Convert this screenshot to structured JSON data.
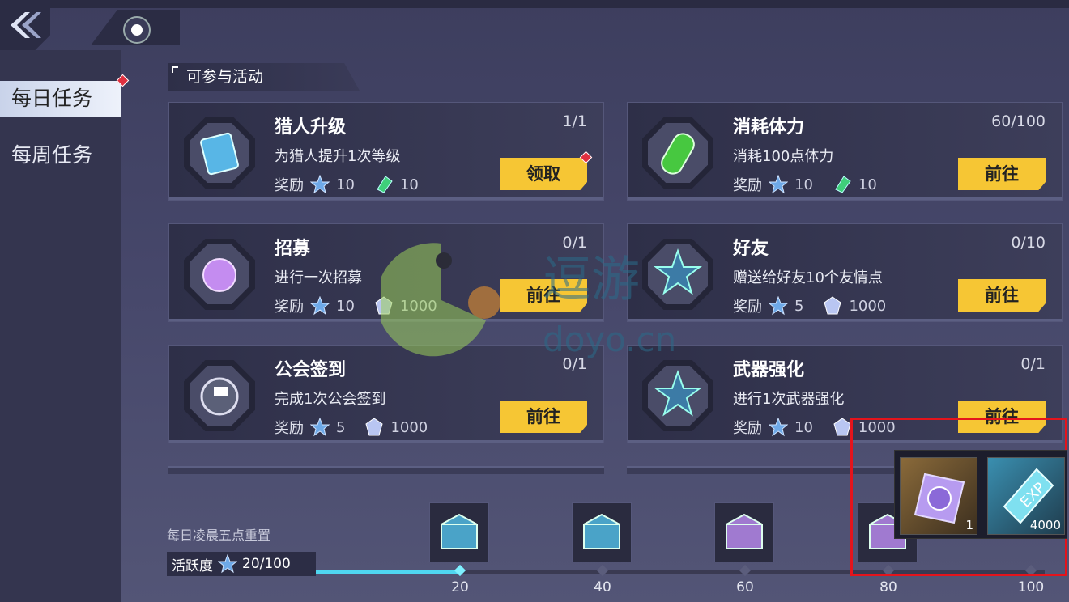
{
  "nav": {
    "back": "back",
    "home": "home"
  },
  "sidebar": {
    "tabs": [
      {
        "label": "每日任务",
        "active": true,
        "has_alert": true
      },
      {
        "label": "每周任务",
        "active": false,
        "has_alert": false
      }
    ]
  },
  "section": {
    "title": "可参与活动"
  },
  "tasks": [
    {
      "title": "猎人升级",
      "progress": "1/1",
      "desc": "为猎人提升1次等级",
      "reward_label": "奖励",
      "rewards": [
        {
          "icon": "activity-star-icon",
          "value": "10"
        },
        {
          "icon": "green-ticket-icon",
          "value": "10"
        }
      ],
      "action": "领取",
      "has_alert": true,
      "icon": "hunter-book-icon"
    },
    {
      "title": "消耗体力",
      "progress": "60/100",
      "desc": "消耗100点体力",
      "reward_label": "奖励",
      "rewards": [
        {
          "icon": "activity-star-icon",
          "value": "10"
        },
        {
          "icon": "green-ticket-icon",
          "value": "10"
        }
      ],
      "action": "前往",
      "has_alert": false,
      "icon": "stamina-potion-icon"
    },
    {
      "title": "招募",
      "progress": "0/1",
      "desc": "进行一次招募",
      "reward_label": "奖励",
      "rewards": [
        {
          "icon": "activity-star-icon",
          "value": "10"
        },
        {
          "icon": "crystal-icon",
          "value": "1000"
        }
      ],
      "action": "前往",
      "has_alert": false,
      "icon": "recruit-puzzle-icon"
    },
    {
      "title": "好友",
      "progress": "0/10",
      "desc": "赠送给好友10个友情点",
      "reward_label": "奖励",
      "rewards": [
        {
          "icon": "activity-star-icon",
          "value": "5"
        },
        {
          "icon": "crystal-icon",
          "value": "1000"
        }
      ],
      "action": "前往",
      "has_alert": false,
      "icon": "friend-star-icon"
    },
    {
      "title": "公会签到",
      "progress": "0/1",
      "desc": "完成1次公会签到",
      "reward_label": "奖励",
      "rewards": [
        {
          "icon": "activity-star-icon",
          "value": "5"
        },
        {
          "icon": "crystal-icon",
          "value": "1000"
        }
      ],
      "action": "前往",
      "has_alert": false,
      "icon": "guild-flag-icon"
    },
    {
      "title": "武器强化",
      "progress": "0/1",
      "desc": "进行1次武器强化",
      "reward_label": "奖励",
      "rewards": [
        {
          "icon": "activity-star-icon",
          "value": "10"
        },
        {
          "icon": "crystal-icon",
          "value": "1000"
        }
      ],
      "action": "前往",
      "has_alert": false,
      "icon": "weapon-star-icon"
    }
  ],
  "bottom": {
    "reset_text": "每日凌晨五点重置",
    "activity_label": "活跃度",
    "activity_value": "20/100",
    "activity_progress": 0.2,
    "milestones": [
      "20",
      "40",
      "60",
      "80",
      "100"
    ]
  },
  "popup": {
    "items": [
      {
        "icon": "purple-ticket-icon",
        "count": "1"
      },
      {
        "icon": "exp-card-icon",
        "count": "4000",
        "badge": "EXP"
      }
    ]
  },
  "watermark": {
    "text": "逗游",
    "domain": "doyo.cn"
  },
  "colors": {
    "action_button": "#f6c634",
    "progress_fill": "#4fd6f0",
    "highlight": "#e4141c"
  }
}
